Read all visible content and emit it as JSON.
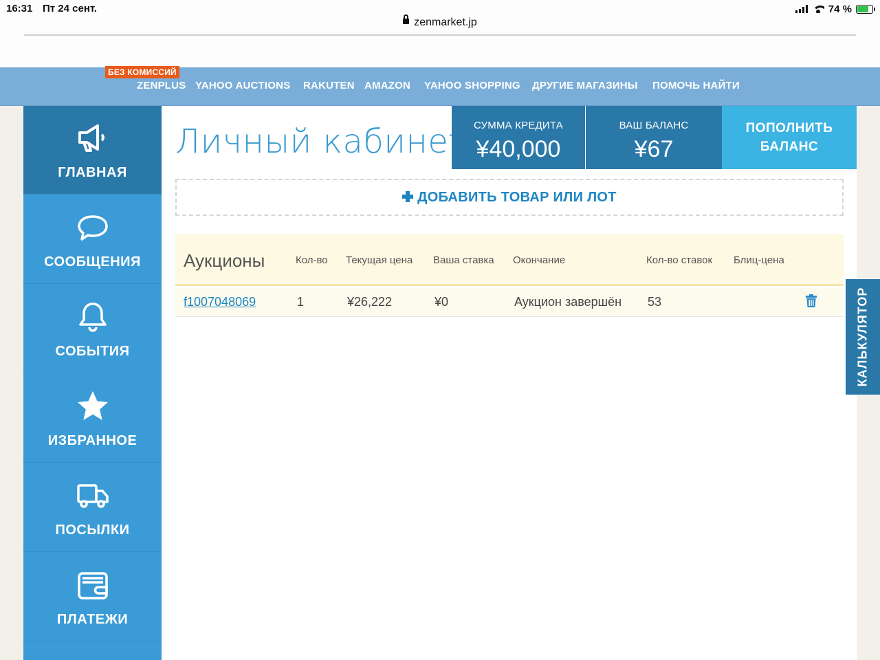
{
  "status_bar": {
    "time": "16:31",
    "date": "Пт 24 сент.",
    "url": "zenmarket.jp",
    "battery": "74 %"
  },
  "nav": {
    "badge": "БЕЗ КОМИССИЙ",
    "items": [
      "ZENPLUS",
      "YAHOO AUCTIONS",
      "RAKUTEN",
      "AMAZON",
      "YAHOO SHOPPING",
      "ДРУГИЕ МАГАЗИНЫ",
      "ПОМОЧЬ НАЙТИ"
    ]
  },
  "sidebar": {
    "items": [
      {
        "label": "ГЛАВНАЯ",
        "icon": "megaphone-icon"
      },
      {
        "label": "СООБЩЕНИЯ",
        "icon": "chat-bubble-icon"
      },
      {
        "label": "СОБЫТИЯ",
        "icon": "bell-icon"
      },
      {
        "label": "ИЗБРАННОЕ",
        "icon": "star-icon"
      },
      {
        "label": "ПОСЫЛКИ",
        "icon": "truck-icon"
      },
      {
        "label": "ПЛАТЕЖИ",
        "icon": "wallet-icon"
      }
    ]
  },
  "header": {
    "title": "Личный кабинет",
    "credit_label": "СУММА КРЕДИТА",
    "credit_value": "¥40,000",
    "balance_label": "ВАШ БАЛАНС",
    "balance_value": "¥67",
    "topup_line1": "ПОПОЛНИТЬ",
    "topup_line2": "БАЛАНС"
  },
  "add_item": {
    "label": "ДОБАВИТЬ ТОВАР ИЛИ ЛОТ"
  },
  "auctions": {
    "title": "Аукционы",
    "columns": [
      "Кол-во",
      "Текущая цена",
      "Ваша ставка",
      "Окончание",
      "Кол-во ставок",
      "Блиц-цена"
    ],
    "rows": [
      {
        "id": "f1007048069",
        "qty": "1",
        "current_price": "¥26,222",
        "your_bid": "¥0",
        "ending": "Аукцион завершён",
        "bids": "53",
        "buyout": ""
      }
    ]
  },
  "calculator": {
    "label": "КАЛЬКУЛЯТОР"
  },
  "colors": {
    "sidebar": "#3a9bd6",
    "sidebar_active": "#2a78a8",
    "accent": "#3bb4e3",
    "badge": "#e85a1a",
    "nav": "#7aaed8"
  }
}
